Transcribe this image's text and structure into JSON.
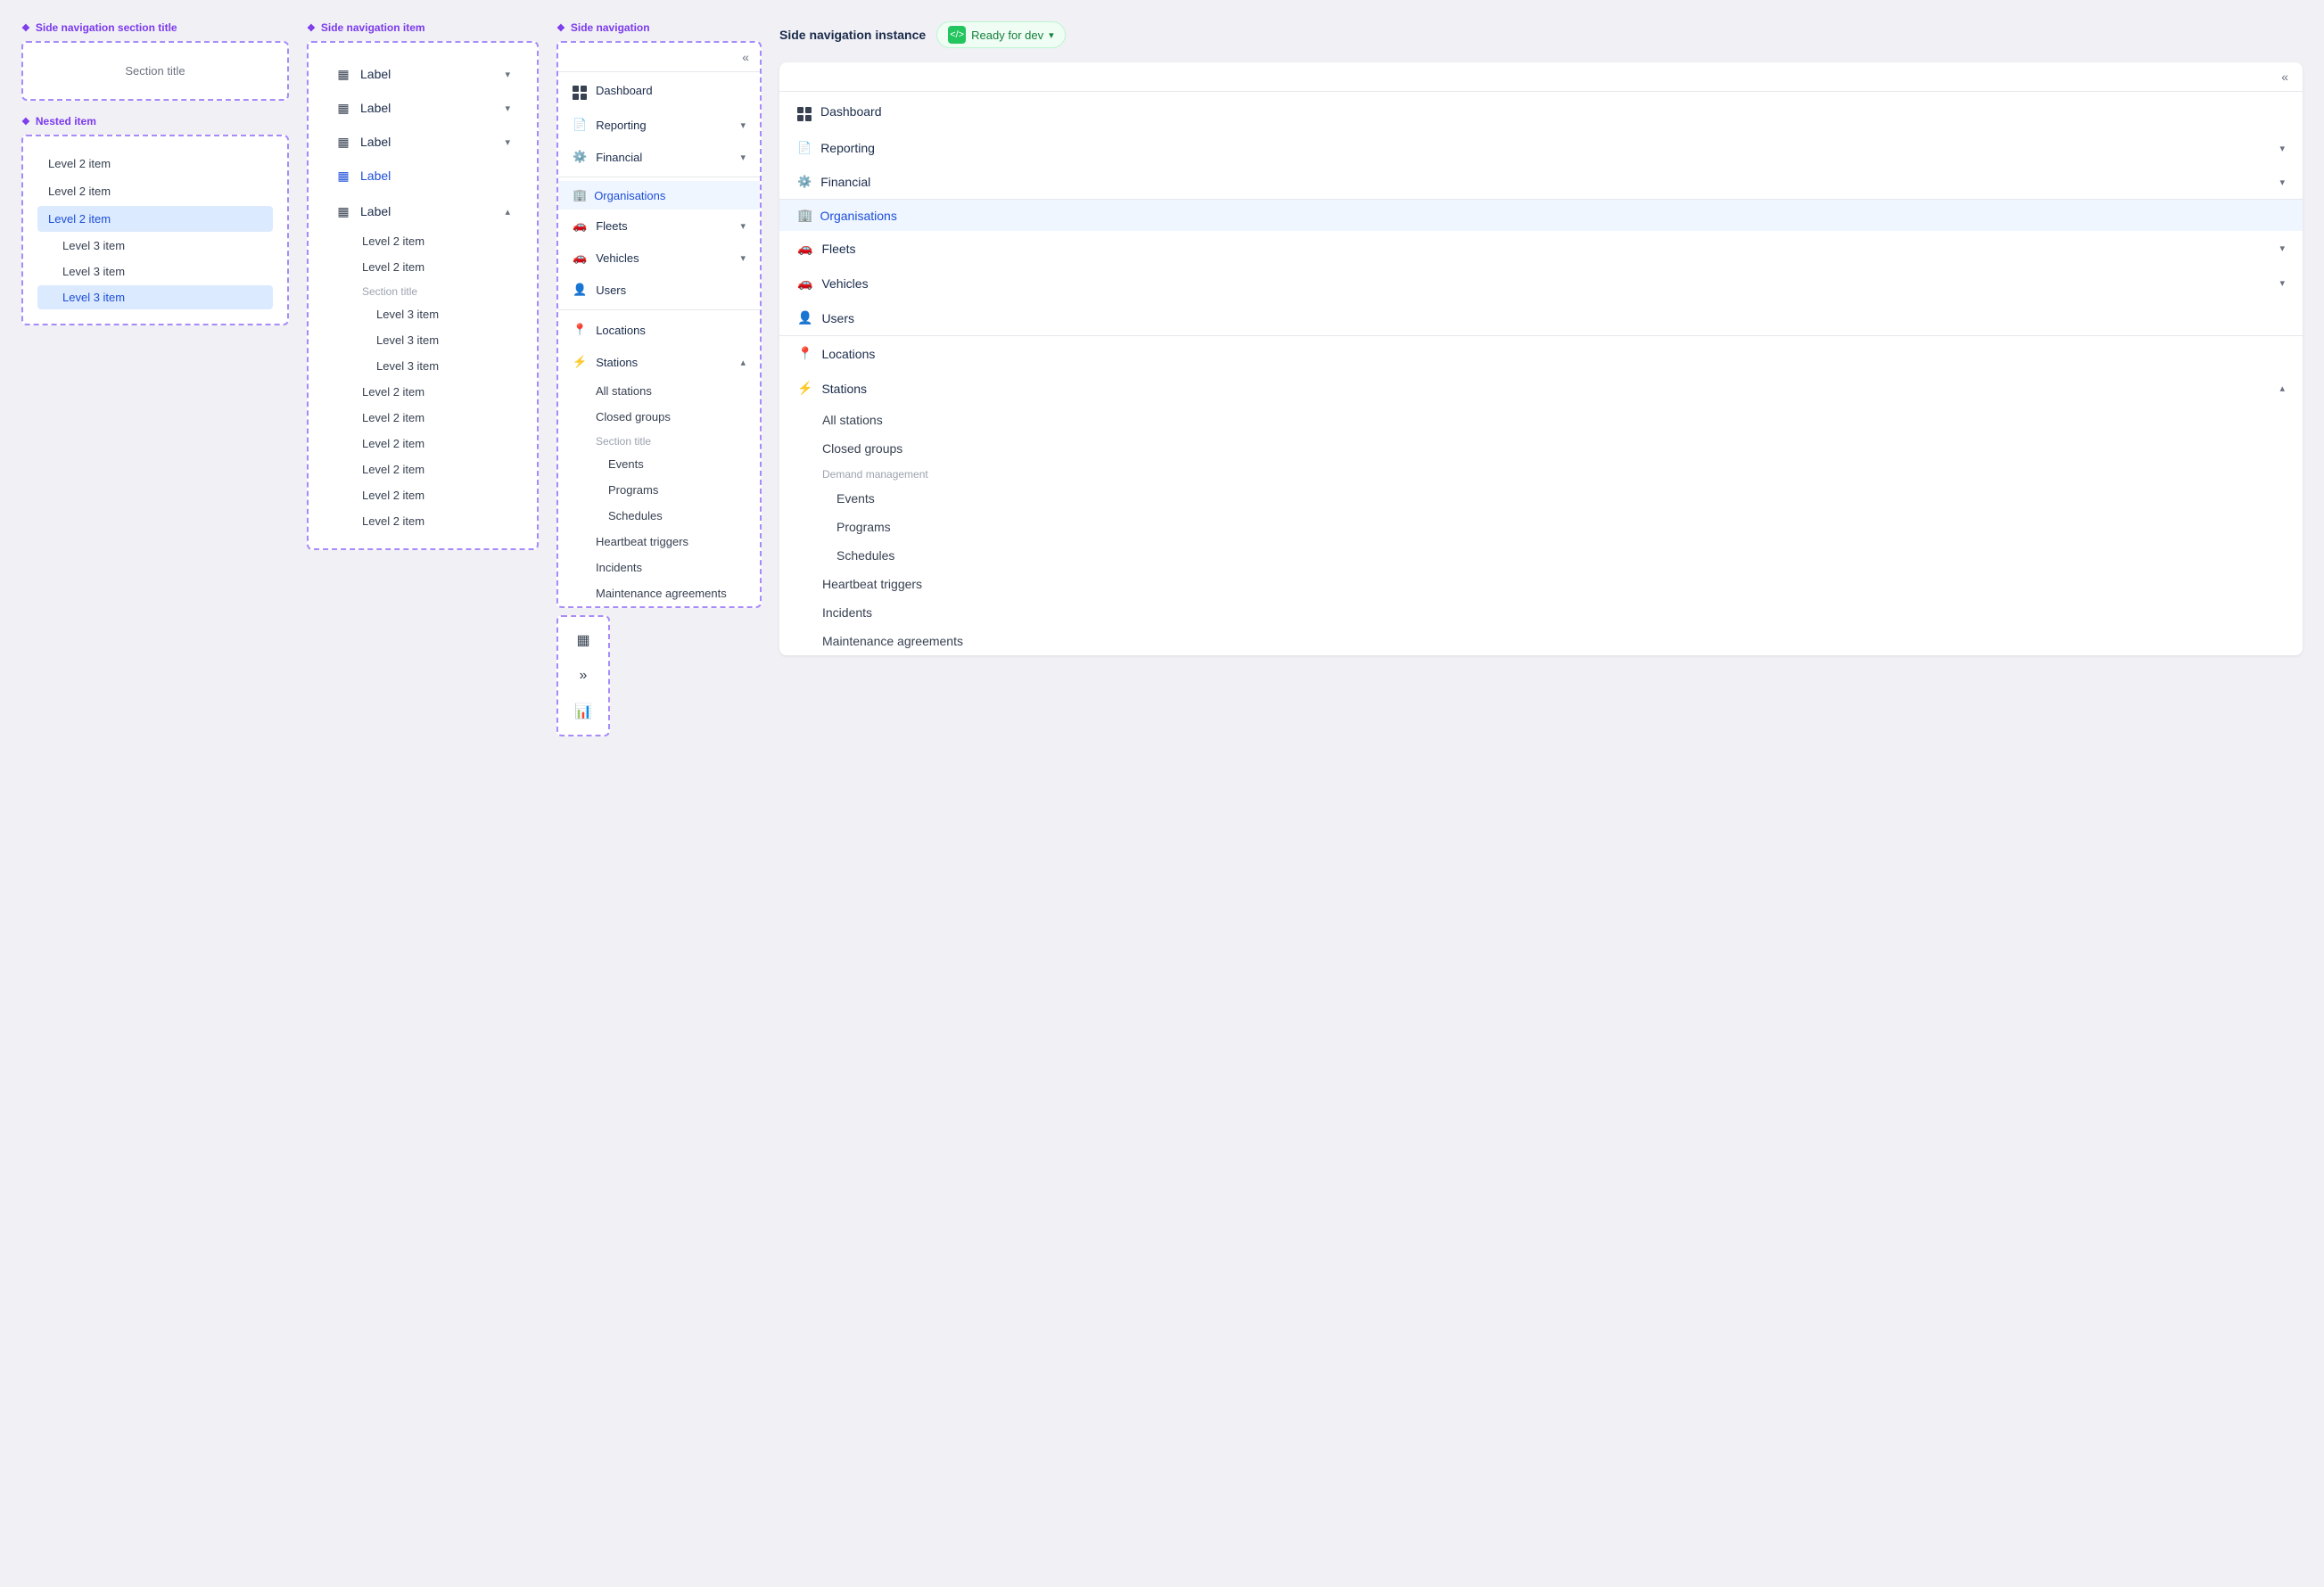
{
  "components": {
    "col1": {
      "label1": "Side navigation section title",
      "section_title": "Section title",
      "label2": "Nested item",
      "items_l2": [
        "Level 2 item",
        "Level 2 item",
        "Level 2 item"
      ],
      "items_l2_active": "Level 2 item",
      "items_l3": [
        "Level 3 item",
        "Level 3 item"
      ],
      "items_l3_active": "Level 3 item"
    },
    "col2": {
      "label": "Side navigation item",
      "items": [
        {
          "label": "Label",
          "expanded": false
        },
        {
          "label": "Label",
          "expanded": false
        },
        {
          "label": "Label",
          "expanded": false
        },
        {
          "label": "Label",
          "expanded": false,
          "active_blue": true
        },
        {
          "label": "Label",
          "expanded": true
        }
      ],
      "expanded_subitems": [
        "Level 2 item",
        "Level 2 item"
      ],
      "section_title": "Section title",
      "l3_items": [
        "Level 3 item",
        "Level 3 item",
        "Level 3 item"
      ],
      "more_l2": [
        "Level 2 item",
        "Level 2 item",
        "Level 2 item",
        "Level 2 item",
        "Level 2 item",
        "Level 2 item"
      ]
    },
    "col3": {
      "label": "Side navigation",
      "nav_items": [
        {
          "label": "Dashboard",
          "icon": "dashboard"
        },
        {
          "label": "Reporting",
          "has_chevron": true
        },
        {
          "label": "Financial",
          "has_chevron": true
        }
      ],
      "section_header": "Organisations",
      "org_items": [
        {
          "label": "Fleets",
          "has_chevron": true
        },
        {
          "label": "Vehicles",
          "has_chevron": true
        },
        {
          "label": "Users"
        }
      ],
      "locations_label": "Locations",
      "stations_label": "Stations",
      "stations_expanded": true,
      "stations_subitems": [
        "All stations",
        "Closed groups"
      ],
      "section_title_inner": "Section title",
      "l3_subitems": [
        "Events",
        "Programs",
        "Schedules"
      ],
      "bottom_items": [
        "Heartbeat triggers",
        "Incidents",
        "Maintenance agreements"
      ],
      "mini_nav": {
        "item1": "▦",
        "item2": "»",
        "item3": "📊"
      }
    },
    "col4": {
      "instance_title": "Side navigation instance",
      "badge_label": "Ready for dev",
      "nav_items": [
        {
          "label": "Dashboard",
          "icon": "dashboard"
        },
        {
          "label": "Reporting",
          "has_chevron": true
        },
        {
          "label": "Financial",
          "has_chevron": true
        }
      ],
      "section_header": "Organisations",
      "org_items": [
        {
          "label": "Fleets",
          "has_chevron": true
        },
        {
          "label": "Vehicles",
          "has_chevron": true
        },
        {
          "label": "Users"
        }
      ],
      "locations_label": "Locations",
      "stations_label": "Stations",
      "stations_expanded": true,
      "stations_subitems": [
        "All stations",
        "Closed groups"
      ],
      "section_title_inner": "Demand management",
      "l3_subitems": [
        "Events",
        "Programs",
        "Schedules"
      ],
      "bottom_items": [
        "Heartbeat triggers",
        "Incidents",
        "Maintenance agreements"
      ]
    }
  }
}
